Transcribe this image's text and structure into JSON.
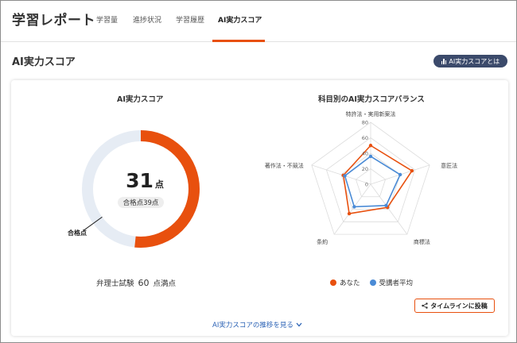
{
  "header": {
    "app_title": "学習レポート",
    "tabs": [
      {
        "label": "学習量",
        "active": false
      },
      {
        "label": "進捗状況",
        "active": false
      },
      {
        "label": "学習履歴",
        "active": false
      },
      {
        "label": "AI実力スコア",
        "active": true
      }
    ]
  },
  "section": {
    "title": "AI実力スコア",
    "info_button_label": "AI実力スコアとは",
    "info_icon": "bar-chart-icon"
  },
  "score_panel": {
    "heading": "AI実力スコア",
    "score": "31",
    "score_unit": "点",
    "passing_pill": "合格点39点",
    "passing_label": "合格点",
    "exam_name": "弁理士試験",
    "max_score": "60",
    "max_suffix": "点満点",
    "donut": {
      "score_value": 31,
      "max_value": 60,
      "passing_value": 39,
      "fill_color": "#e8500e",
      "track_color": "#e6ecf4"
    }
  },
  "radar_panel": {
    "heading": "科目別のAI実力スコアバランス",
    "legend": [
      {
        "label": "あなた",
        "color": "#e8500e"
      },
      {
        "label": "受講者平均",
        "color": "#4a8bd6"
      }
    ]
  },
  "chart_data": {
    "type": "radar",
    "title": "科目別のAI実力スコアバランス",
    "axes": [
      "特許法・実用新案法",
      "意匠法",
      "商標法",
      "条約",
      "著作法・不競法"
    ],
    "scale": {
      "min": 0,
      "max": 80,
      "ticks": [
        0,
        20,
        40,
        60,
        80
      ]
    },
    "series": [
      {
        "name": "あなた",
        "color": "#e8500e",
        "values": [
          50,
          56,
          37,
          47,
          37
        ]
      },
      {
        "name": "受講者平均",
        "color": "#4a8bd6",
        "values": [
          36,
          40,
          34,
          36,
          35
        ]
      }
    ],
    "legend_position": "bottom"
  },
  "actions": {
    "share_label": "タイムラインに投稿",
    "trend_link_label": "AI実力スコアの推移を見る"
  }
}
